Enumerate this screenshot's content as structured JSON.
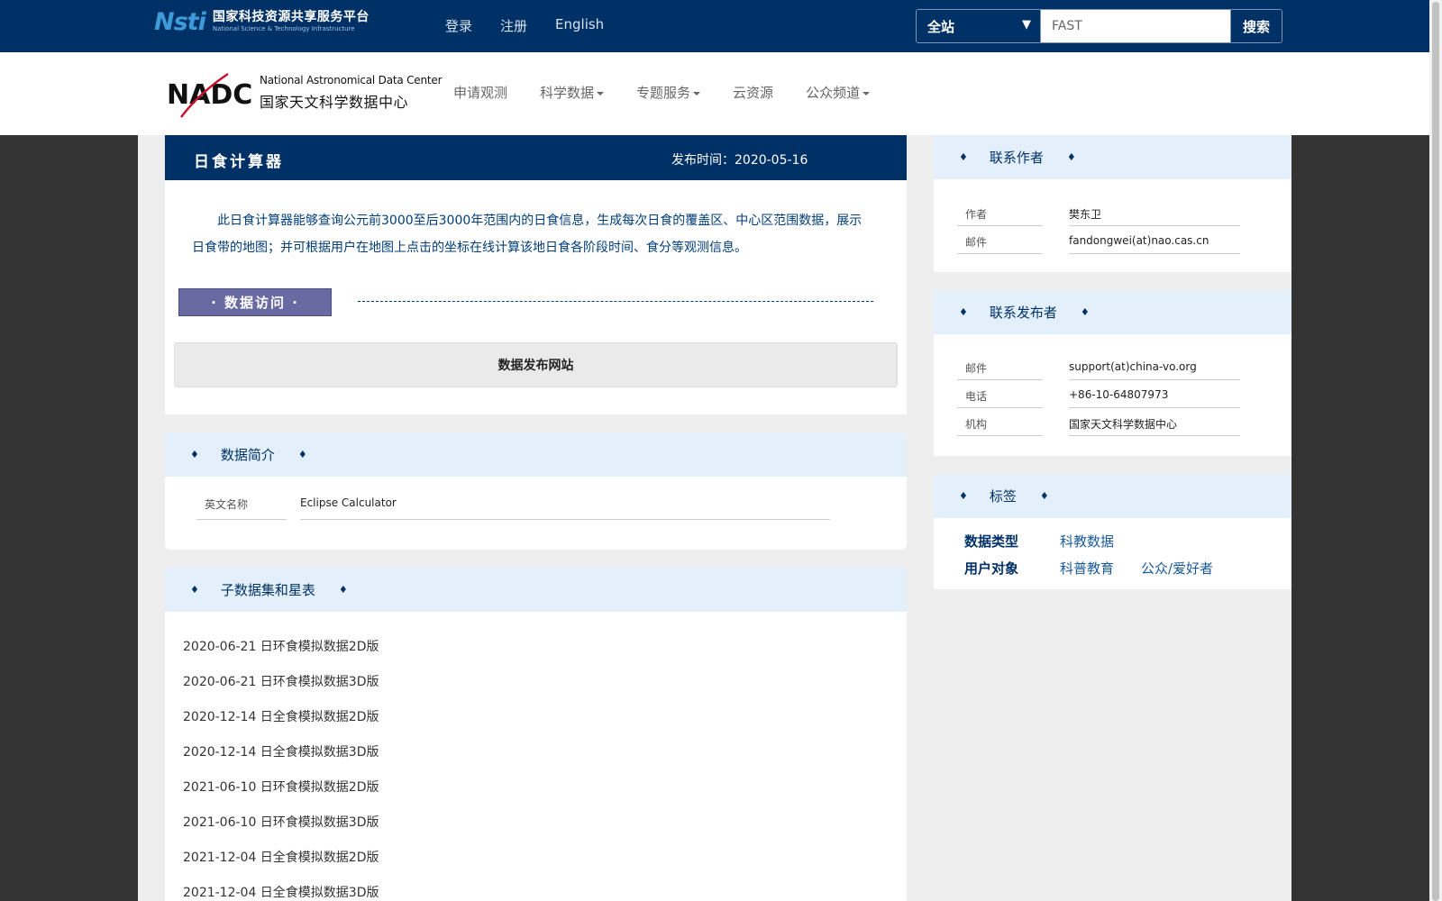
{
  "topbar": {
    "logo_mark": "Nsti",
    "logo_cn": "国家科技资源共享服务平台",
    "logo_en": "National Science & Technology Infrastructure",
    "links": [
      "登录",
      "注册",
      "English"
    ],
    "search_scope": "全站",
    "search_value": "FAST",
    "search_button": "搜索",
    "bg_color": "#003166"
  },
  "header": {
    "logo_mark": "NADC",
    "logo_en": "National Astronomical Data Center",
    "logo_cn": "国家天文科学数据中心",
    "nav": [
      {
        "label": "申请观测",
        "dropdown": false
      },
      {
        "label": "科学数据",
        "dropdown": true
      },
      {
        "label": "专题服务",
        "dropdown": true
      },
      {
        "label": "云资源",
        "dropdown": false
      },
      {
        "label": "公众频道",
        "dropdown": true
      }
    ]
  },
  "article": {
    "title": "日食计算器",
    "date_label": "发布时间：2020-05-16",
    "description": "此日食计算器能够查询公元前3000至后3000年范围内的日食信息，生成每次日食的覆盖区、中心区范围数据，展示日食带的地图；并可根据用户在地图上点击的坐标在线计算该地日食各阶段时间、食分等观测信息。",
    "access_tag": "· 数据访问 ·",
    "access_button": "数据发布网站"
  },
  "summary": {
    "title": "数据简介",
    "rows": [
      {
        "key": "英文名称",
        "value": "Eclipse Calculator"
      }
    ]
  },
  "subsets": {
    "title": "子数据集和星表",
    "items": [
      "2020-06-21 日环食模拟数据2D版",
      "2020-06-21 日环食模拟数据3D版",
      "2020-12-14 日全食模拟数据2D版",
      "2020-12-14 日全食模拟数据3D版",
      "2021-06-10 日环食模拟数据2D版",
      "2021-06-10 日环食模拟数据3D版",
      "2021-12-04 日全食模拟数据2D版",
      "2021-12-04 日全食模拟数据3D版"
    ]
  },
  "contact_author": {
    "title": "联系作者",
    "rows": [
      {
        "key": "作者",
        "value": "樊东卫"
      },
      {
        "key": "邮件",
        "value": "fandongwei(at)nao.cas.cn"
      }
    ]
  },
  "contact_publisher": {
    "title": "联系发布者",
    "rows": [
      {
        "key": "邮件",
        "value": "support(at)china-vo.org"
      },
      {
        "key": "电话",
        "value": "+86-10-64807973"
      },
      {
        "key": "机构",
        "value": "国家天文科学数据中心"
      }
    ]
  },
  "tags": {
    "title": "标签",
    "data_type_label": "数据类型",
    "data_type_values": [
      "科教数据"
    ],
    "audience_label": "用户对象",
    "audience_values": [
      "科普教育",
      "公众/爱好者"
    ]
  },
  "diamond": "♦",
  "colors": {
    "brand": "#003166",
    "band": "#e3f0fb",
    "access_tag": "#6a6aa3",
    "page_bg": "#333333",
    "content_bg": "#eeeeee"
  }
}
